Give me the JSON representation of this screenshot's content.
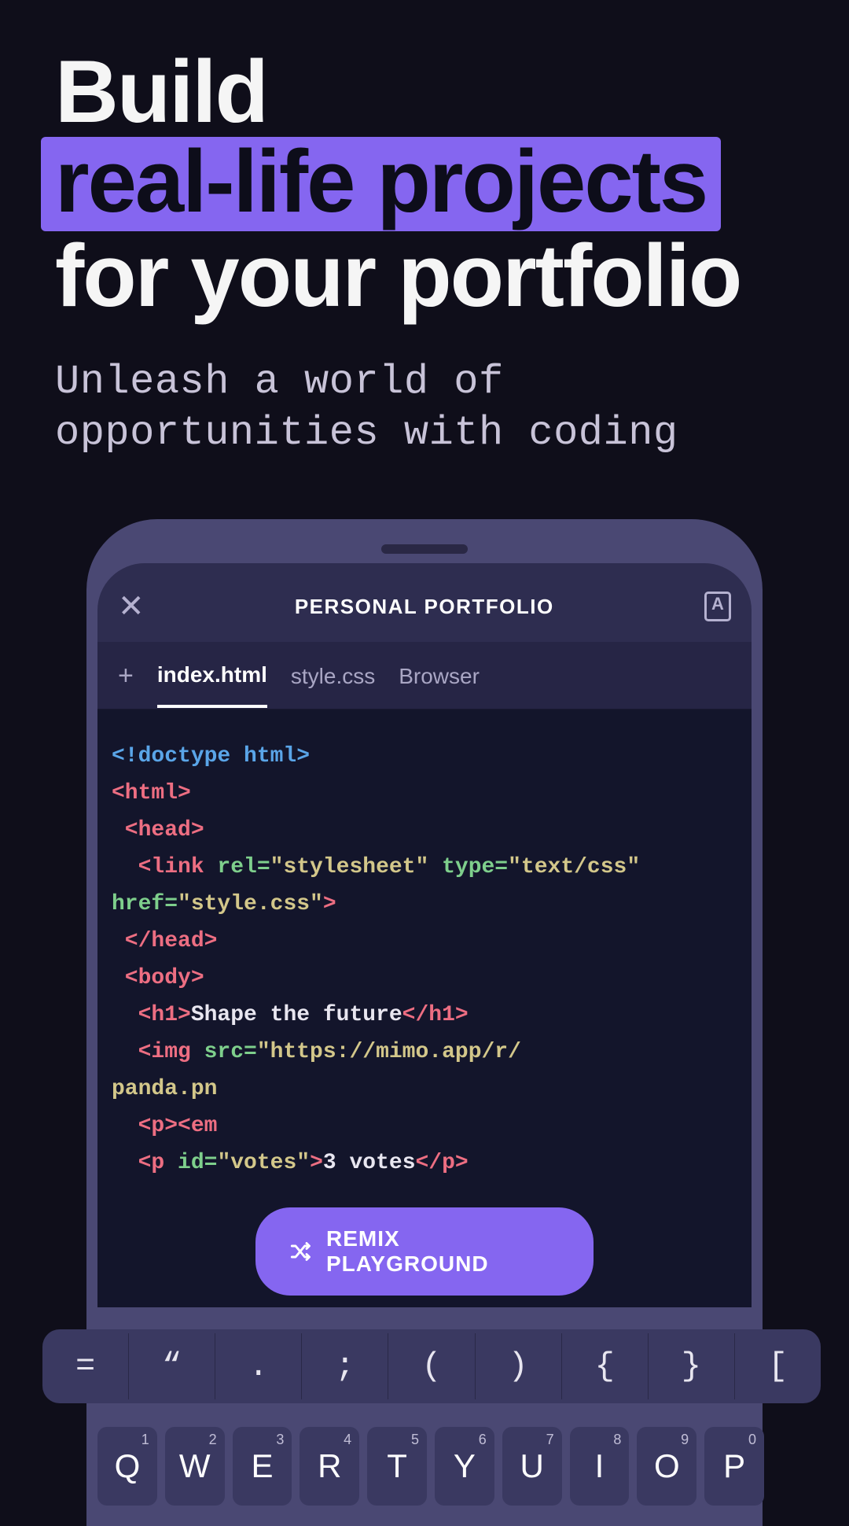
{
  "hero": {
    "line1": "Build",
    "highlight": "real-life projects",
    "line3": "for your portfolio",
    "subtitle": "Unleash a world of opportunities with coding"
  },
  "editor": {
    "title": "PERSONAL PORTFOLIO",
    "tabs": {
      "t0": "index.html",
      "t1": "style.css",
      "t2": "Browser"
    },
    "remix_label": "REMIX PLAYGROUND"
  },
  "code": {
    "doctype": "<!doctype html>",
    "html_open": "<html>",
    "head_open": " <head>",
    "link_a": "  <link",
    "rel_attr": " rel=",
    "rel_val": "\"stylesheet\"",
    "type_attr": " type=",
    "type_val": "\"text/css\"",
    "href_attr": "href=",
    "href_val": "\"style.css\"",
    "close_gt": ">",
    "head_close": " </head>",
    "body_open": " <body>",
    "h1_open": "  <h1>",
    "h1_text": "Shape the future",
    "h1_close": "</h1>",
    "img_open": "  <img",
    "src_attr": " src=",
    "src_val1": "\"https://mimo.app/r/",
    "src_val2": "panda.pn",
    "p_em": "  <p><em",
    "p_id_open": "  <p",
    "id_attr": " id=",
    "id_val": "\"votes\"",
    "votes_text": "3 votes",
    "p_close": "</p>"
  },
  "symrow": {
    "k0": "=",
    "k1": "“",
    "k2": ".",
    "k3": ";",
    "k4": "(",
    "k5": ")",
    "k6": "{",
    "k7": "}",
    "k8": "["
  },
  "keys": {
    "k0": {
      "l": "Q",
      "n": "1"
    },
    "k1": {
      "l": "W",
      "n": "2"
    },
    "k2": {
      "l": "E",
      "n": "3"
    },
    "k3": {
      "l": "R",
      "n": "4"
    },
    "k4": {
      "l": "T",
      "n": "5"
    },
    "k5": {
      "l": "Y",
      "n": "6"
    },
    "k6": {
      "l": "U",
      "n": "7"
    },
    "k7": {
      "l": "I",
      "n": "8"
    },
    "k8": {
      "l": "O",
      "n": "9"
    },
    "k9": {
      "l": "P",
      "n": "0"
    }
  }
}
